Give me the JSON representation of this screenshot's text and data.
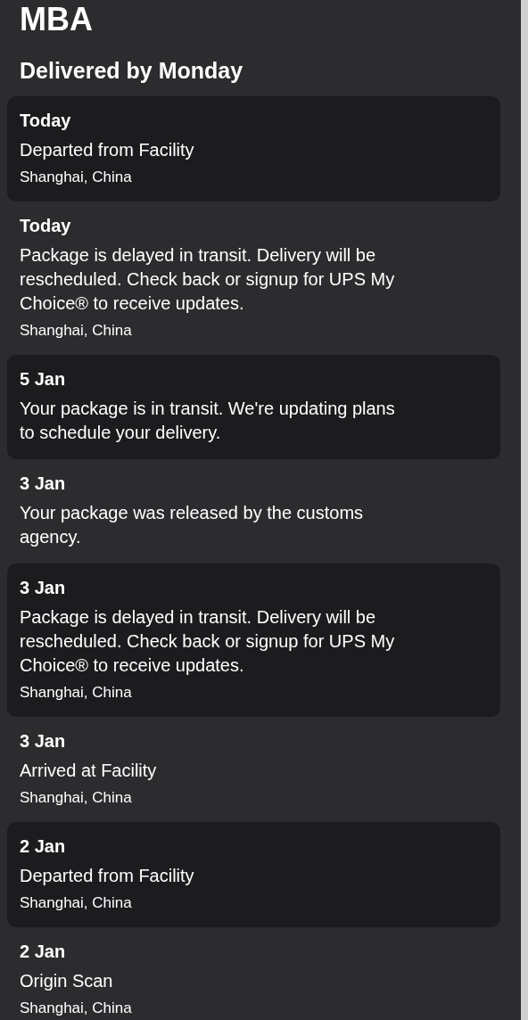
{
  "title": "MBA",
  "subtitle": "Delivered by Monday",
  "events": [
    {
      "date": "Today",
      "description": "Departed from Facility",
      "location": "Shanghai, China",
      "shaded": true
    },
    {
      "date": "Today",
      "description": "Package is delayed in transit. Delivery will be rescheduled. Check back or signup for UPS My Choice® to receive updates.",
      "location": "Shanghai, China",
      "shaded": false
    },
    {
      "date": "5 Jan",
      "description": "Your package is in transit. We're updating plans to schedule your delivery.",
      "shaded": true
    },
    {
      "date": "3 Jan",
      "description": "Your package was released by the customs agency.",
      "shaded": false
    },
    {
      "date": "3 Jan",
      "description": "Package is delayed in transit. Delivery will be rescheduled. Check back or signup for UPS My Choice® to receive updates.",
      "location": "Shanghai, China",
      "shaded": true
    },
    {
      "date": "3 Jan",
      "description": "Arrived at Facility",
      "location": "Shanghai, China",
      "shaded": false
    },
    {
      "date": "2 Jan",
      "description": "Departed from Facility",
      "location": "Shanghai, China",
      "shaded": true
    },
    {
      "date": "2 Jan",
      "description": "Origin Scan",
      "location": "Shanghai, China",
      "shaded": false
    }
  ]
}
